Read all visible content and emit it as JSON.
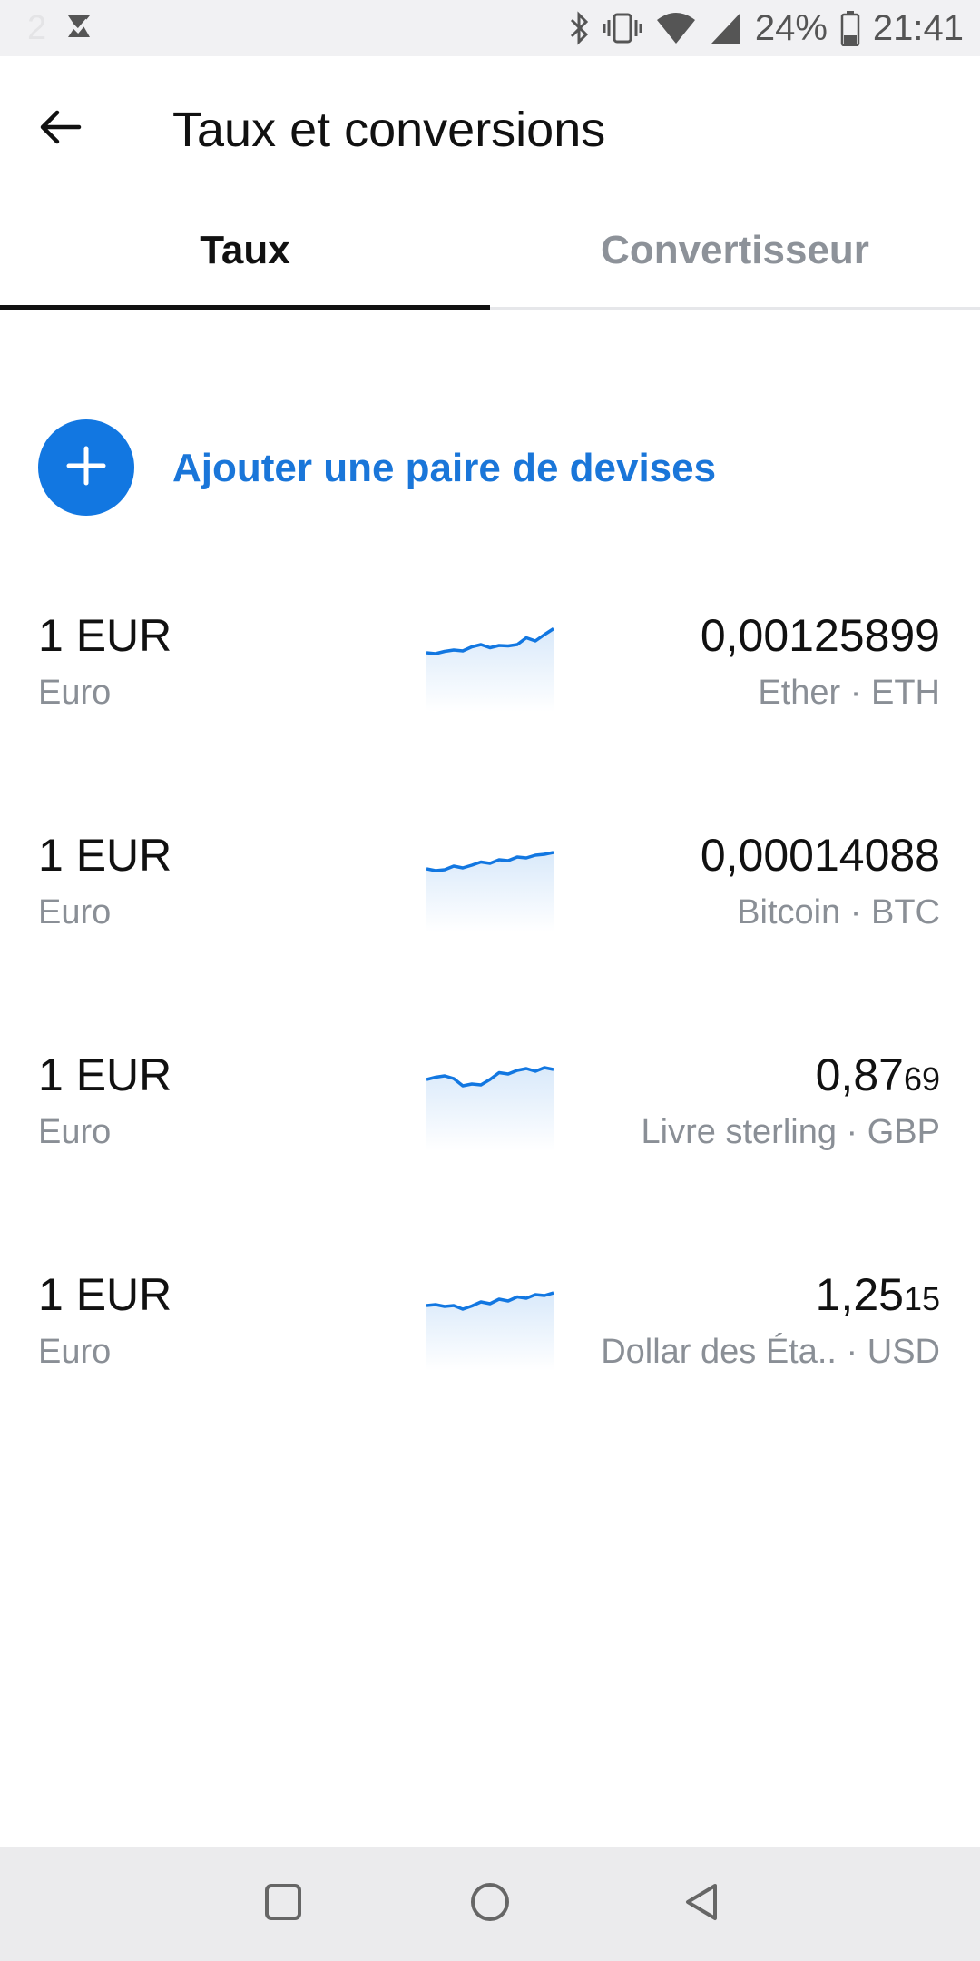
{
  "status_bar": {
    "left_faded_text": "2",
    "battery": "24%",
    "time": "21:41",
    "icons": [
      "app-notification-icon",
      "bluetooth-icon",
      "vibrate-icon",
      "wifi-icon",
      "signal-icon",
      "battery-icon"
    ]
  },
  "header": {
    "title": "Taux et conversions",
    "back_icon": "arrow-left-icon"
  },
  "tabs": [
    {
      "label": "Taux",
      "active": true
    },
    {
      "label": "Convertisseur",
      "active": false
    }
  ],
  "add_pair": {
    "label": "Ajouter une paire de devises",
    "icon": "plus-icon"
  },
  "accent_color": "#1277e1",
  "rates": [
    {
      "amount": "1 EUR",
      "base": "Euro",
      "value_main": "0,00125899",
      "value_small": "",
      "quote": "Ether · ETH",
      "trend": [
        0.22,
        0.2,
        0.25,
        0.28,
        0.26,
        0.35,
        0.4,
        0.33,
        0.38,
        0.37,
        0.4,
        0.55,
        0.48,
        0.62,
        0.75
      ]
    },
    {
      "amount": "1 EUR",
      "base": "Euro",
      "value_main": "0,00014088",
      "value_small": "",
      "quote": "Bitcoin · BTC",
      "trend": [
        0.3,
        0.26,
        0.28,
        0.36,
        0.32,
        0.38,
        0.45,
        0.42,
        0.5,
        0.48,
        0.56,
        0.54,
        0.6,
        0.62,
        0.66
      ]
    },
    {
      "amount": "1 EUR",
      "base": "Euro",
      "value_main": "0,87",
      "value_small": "69",
      "quote": "Livre sterling · GBP",
      "trend": [
        0.5,
        0.55,
        0.58,
        0.52,
        0.36,
        0.4,
        0.38,
        0.5,
        0.65,
        0.62,
        0.7,
        0.74,
        0.68,
        0.76,
        0.72
      ]
    },
    {
      "amount": "1 EUR",
      "base": "Euro",
      "value_main": "1,25",
      "value_small": "15",
      "quote": "Dollar des Éta.. · USD",
      "trend": [
        0.36,
        0.38,
        0.34,
        0.36,
        0.28,
        0.35,
        0.44,
        0.4,
        0.5,
        0.46,
        0.55,
        0.52,
        0.6,
        0.58,
        0.64
      ]
    }
  ],
  "nav_bar": {
    "buttons": [
      "square-recent-icon",
      "circle-home-icon",
      "triangle-back-icon"
    ]
  }
}
